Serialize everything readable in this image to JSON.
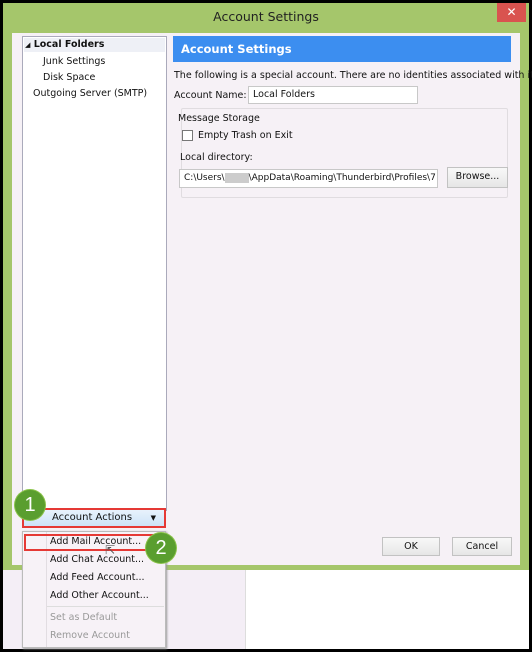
{
  "window": {
    "title": "Account Settings",
    "close_icon": "close-icon"
  },
  "tree": {
    "items": [
      {
        "label": "Local Folders",
        "expanded": true
      },
      {
        "label": "Junk Settings"
      },
      {
        "label": "Disk Space"
      },
      {
        "label": "Outgoing Server (SMTP)"
      }
    ]
  },
  "account_actions": {
    "label": "Account Actions",
    "menu": [
      {
        "label": "Add Mail Account...",
        "enabled": true
      },
      {
        "label": "Add Chat Account...",
        "enabled": true
      },
      {
        "label": "Add Feed Account...",
        "enabled": true
      },
      {
        "label": "Add Other Account...",
        "enabled": true
      },
      {
        "label": "Set as Default",
        "enabled": false
      },
      {
        "label": "Remove Account",
        "enabled": false
      }
    ]
  },
  "annotations": {
    "step1": "1",
    "step2": "2",
    "highlight_color": "#e53935",
    "badge_color": "#5a9e2f"
  },
  "main": {
    "header": "Account Settings",
    "header_color": "#3c8ef0",
    "description": "The following is a special account. There are no identities associated with it.",
    "account_name_label": "Account Name:",
    "account_name_value": "Local Folders",
    "storage_legend": "Message Storage",
    "empty_trash_label": "Empty Trash on Exit",
    "empty_trash_checked": false,
    "local_dir_label": "Local directory:",
    "local_dir_prefix": "C:\\Users\\",
    "local_dir_suffix": "\\AppData\\Roaming\\Thunderbird\\Profiles\\7",
    "browse_label": "Browse..."
  },
  "footer": {
    "ok": "OK",
    "cancel": "Cancel"
  }
}
